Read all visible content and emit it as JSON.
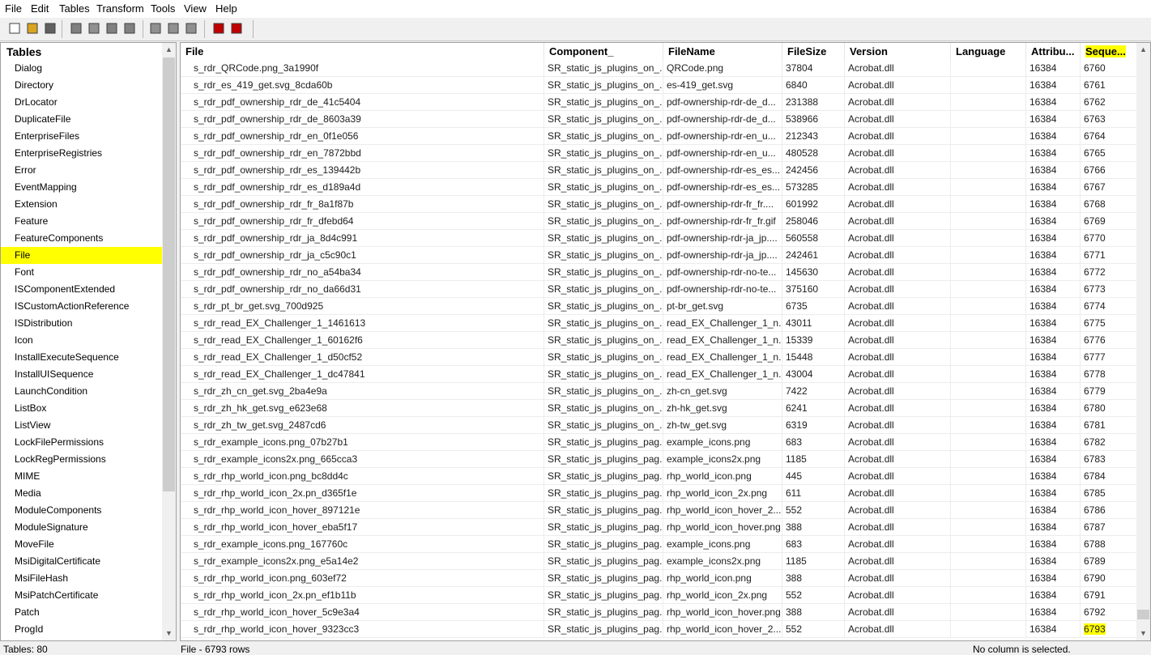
{
  "menu": [
    "File",
    "Edit",
    "Tables",
    "Transform",
    "Tools",
    "View",
    "Help"
  ],
  "toolbar_icons": [
    "new-file-icon",
    "open-folder-icon",
    "save-icon",
    "cut-icon",
    "copy-icon",
    "paste-icon",
    "delete-icon",
    "find-icon",
    "find-next-icon",
    "replace-icon",
    "transform-icon",
    "validate-icon"
  ],
  "tables_panel": {
    "title": "Tables",
    "items": [
      "Dialog",
      "Directory",
      "DrLocator",
      "DuplicateFile",
      "EnterpriseFiles",
      "EnterpriseRegistries",
      "Error",
      "EventMapping",
      "Extension",
      "Feature",
      "FeatureComponents",
      "File",
      "Font",
      "ISComponentExtended",
      "ISCustomActionReference",
      "ISDistribution",
      "Icon",
      "InstallExecuteSequence",
      "InstallUISequence",
      "LaunchCondition",
      "ListBox",
      "ListView",
      "LockFilePermissions",
      "LockRegPermissions",
      "MIME",
      "Media",
      "ModuleComponents",
      "ModuleSignature",
      "MoveFile",
      "MsiDigitalCertificate",
      "MsiFileHash",
      "MsiPatchCertificate",
      "Patch",
      "ProgId"
    ],
    "selected": "File"
  },
  "grid": {
    "columns": [
      "File",
      "Component_",
      "FileName",
      "FileSize",
      "Version",
      "Language",
      "Attribu...",
      "Seque..."
    ],
    "rows": [
      [
        "s_rdr_QRCode.png_3a1990f",
        "SR_static_js_plugins_on_...",
        "QRCode.png",
        "37804",
        "Acrobat.dll",
        "",
        "16384",
        "6760"
      ],
      [
        "s_rdr_es_419_get.svg_8cda60b",
        "SR_static_js_plugins_on_...",
        "es-419_get.svg",
        "6840",
        "Acrobat.dll",
        "",
        "16384",
        "6761"
      ],
      [
        "s_rdr_pdf_ownership_rdr_de_41c5404",
        "SR_static_js_plugins_on_...",
        "pdf-ownership-rdr-de_d...",
        "231388",
        "Acrobat.dll",
        "",
        "16384",
        "6762"
      ],
      [
        "s_rdr_pdf_ownership_rdr_de_8603a39",
        "SR_static_js_plugins_on_...",
        "pdf-ownership-rdr-de_d...",
        "538966",
        "Acrobat.dll",
        "",
        "16384",
        "6763"
      ],
      [
        "s_rdr_pdf_ownership_rdr_en_0f1e056",
        "SR_static_js_plugins_on_...",
        "pdf-ownership-rdr-en_u...",
        "212343",
        "Acrobat.dll",
        "",
        "16384",
        "6764"
      ],
      [
        "s_rdr_pdf_ownership_rdr_en_7872bbd",
        "SR_static_js_plugins_on_...",
        "pdf-ownership-rdr-en_u...",
        "480528",
        "Acrobat.dll",
        "",
        "16384",
        "6765"
      ],
      [
        "s_rdr_pdf_ownership_rdr_es_139442b",
        "SR_static_js_plugins_on_...",
        "pdf-ownership-rdr-es_es...",
        "242456",
        "Acrobat.dll",
        "",
        "16384",
        "6766"
      ],
      [
        "s_rdr_pdf_ownership_rdr_es_d189a4d",
        "SR_static_js_plugins_on_...",
        "pdf-ownership-rdr-es_es...",
        "573285",
        "Acrobat.dll",
        "",
        "16384",
        "6767"
      ],
      [
        "s_rdr_pdf_ownership_rdr_fr_8a1f87b",
        "SR_static_js_plugins_on_...",
        "pdf-ownership-rdr-fr_fr....",
        "601992",
        "Acrobat.dll",
        "",
        "16384",
        "6768"
      ],
      [
        "s_rdr_pdf_ownership_rdr_fr_dfebd64",
        "SR_static_js_plugins_on_...",
        "pdf-ownership-rdr-fr_fr.gif",
        "258046",
        "Acrobat.dll",
        "",
        "16384",
        "6769"
      ],
      [
        "s_rdr_pdf_ownership_rdr_ja_8d4c991",
        "SR_static_js_plugins_on_...",
        "pdf-ownership-rdr-ja_jp....",
        "560558",
        "Acrobat.dll",
        "",
        "16384",
        "6770"
      ],
      [
        "s_rdr_pdf_ownership_rdr_ja_c5c90c1",
        "SR_static_js_plugins_on_...",
        "pdf-ownership-rdr-ja_jp....",
        "242461",
        "Acrobat.dll",
        "",
        "16384",
        "6771"
      ],
      [
        "s_rdr_pdf_ownership_rdr_no_a54ba34",
        "SR_static_js_plugins_on_...",
        "pdf-ownership-rdr-no-te...",
        "145630",
        "Acrobat.dll",
        "",
        "16384",
        "6772"
      ],
      [
        "s_rdr_pdf_ownership_rdr_no_da66d31",
        "SR_static_js_plugins_on_...",
        "pdf-ownership-rdr-no-te...",
        "375160",
        "Acrobat.dll",
        "",
        "16384",
        "6773"
      ],
      [
        "s_rdr_pt_br_get.svg_700d925",
        "SR_static_js_plugins_on_...",
        "pt-br_get.svg",
        "6735",
        "Acrobat.dll",
        "",
        "16384",
        "6774"
      ],
      [
        "s_rdr_read_EX_Challenger_1_1461613",
        "SR_static_js_plugins_on_...",
        "read_EX_Challenger_1_n...",
        "43011",
        "Acrobat.dll",
        "",
        "16384",
        "6775"
      ],
      [
        "s_rdr_read_EX_Challenger_1_60162f6",
        "SR_static_js_plugins_on_...",
        "read_EX_Challenger_1_n...",
        "15339",
        "Acrobat.dll",
        "",
        "16384",
        "6776"
      ],
      [
        "s_rdr_read_EX_Challenger_1_d50cf52",
        "SR_static_js_plugins_on_...",
        "read_EX_Challenger_1_n...",
        "15448",
        "Acrobat.dll",
        "",
        "16384",
        "6777"
      ],
      [
        "s_rdr_read_EX_Challenger_1_dc47841",
        "SR_static_js_plugins_on_...",
        "read_EX_Challenger_1_n...",
        "43004",
        "Acrobat.dll",
        "",
        "16384",
        "6778"
      ],
      [
        "s_rdr_zh_cn_get.svg_2ba4e9a",
        "SR_static_js_plugins_on_...",
        "zh-cn_get.svg",
        "7422",
        "Acrobat.dll",
        "",
        "16384",
        "6779"
      ],
      [
        "s_rdr_zh_hk_get.svg_e623e68",
        "SR_static_js_plugins_on_...",
        "zh-hk_get.svg",
        "6241",
        "Acrobat.dll",
        "",
        "16384",
        "6780"
      ],
      [
        "s_rdr_zh_tw_get.svg_2487cd6",
        "SR_static_js_plugins_on_...",
        "zh-tw_get.svg",
        "6319",
        "Acrobat.dll",
        "",
        "16384",
        "6781"
      ],
      [
        "s_rdr_example_icons.png_07b27b1",
        "SR_static_js_plugins_pag...",
        "example_icons.png",
        "683",
        "Acrobat.dll",
        "",
        "16384",
        "6782"
      ],
      [
        "s_rdr_example_icons2x.png_665cca3",
        "SR_static_js_plugins_pag...",
        "example_icons2x.png",
        "1185",
        "Acrobat.dll",
        "",
        "16384",
        "6783"
      ],
      [
        "s_rdr_rhp_world_icon.png_bc8dd4c",
        "SR_static_js_plugins_pag...",
        "rhp_world_icon.png",
        "445",
        "Acrobat.dll",
        "",
        "16384",
        "6784"
      ],
      [
        "s_rdr_rhp_world_icon_2x.pn_d365f1e",
        "SR_static_js_plugins_pag...",
        "rhp_world_icon_2x.png",
        "611",
        "Acrobat.dll",
        "",
        "16384",
        "6785"
      ],
      [
        "s_rdr_rhp_world_icon_hover_897121e",
        "SR_static_js_plugins_pag...",
        "rhp_world_icon_hover_2...",
        "552",
        "Acrobat.dll",
        "",
        "16384",
        "6786"
      ],
      [
        "s_rdr_rhp_world_icon_hover_eba5f17",
        "SR_static_js_plugins_pag...",
        "rhp_world_icon_hover.png",
        "388",
        "Acrobat.dll",
        "",
        "16384",
        "6787"
      ],
      [
        "s_rdr_example_icons.png_167760c",
        "SR_static_js_plugins_pag...",
        "example_icons.png",
        "683",
        "Acrobat.dll",
        "",
        "16384",
        "6788"
      ],
      [
        "s_rdr_example_icons2x.png_e5a14e2",
        "SR_static_js_plugins_pag...",
        "example_icons2x.png",
        "1185",
        "Acrobat.dll",
        "",
        "16384",
        "6789"
      ],
      [
        "s_rdr_rhp_world_icon.png_603ef72",
        "SR_static_js_plugins_pag...",
        "rhp_world_icon.png",
        "388",
        "Acrobat.dll",
        "",
        "16384",
        "6790"
      ],
      [
        "s_rdr_rhp_world_icon_2x.pn_ef1b11b",
        "SR_static_js_plugins_pag...",
        "rhp_world_icon_2x.png",
        "552",
        "Acrobat.dll",
        "",
        "16384",
        "6791"
      ],
      [
        "s_rdr_rhp_world_icon_hover_5c9e3a4",
        "SR_static_js_plugins_pag...",
        "rhp_world_icon_hover.png",
        "388",
        "Acrobat.dll",
        "",
        "16384",
        "6792"
      ],
      [
        "s_rdr_rhp_world_icon_hover_9323cc3",
        "SR_static_js_plugins_pag...",
        "rhp_world_icon_hover_2...",
        "552",
        "Acrobat.dll",
        "",
        "16384",
        "6793"
      ]
    ]
  },
  "status": {
    "tables_count": "Tables: 80",
    "rows_info": "File - 6793 rows",
    "selection": "No column is selected."
  },
  "colors": {
    "highlight": "#ffff00"
  }
}
